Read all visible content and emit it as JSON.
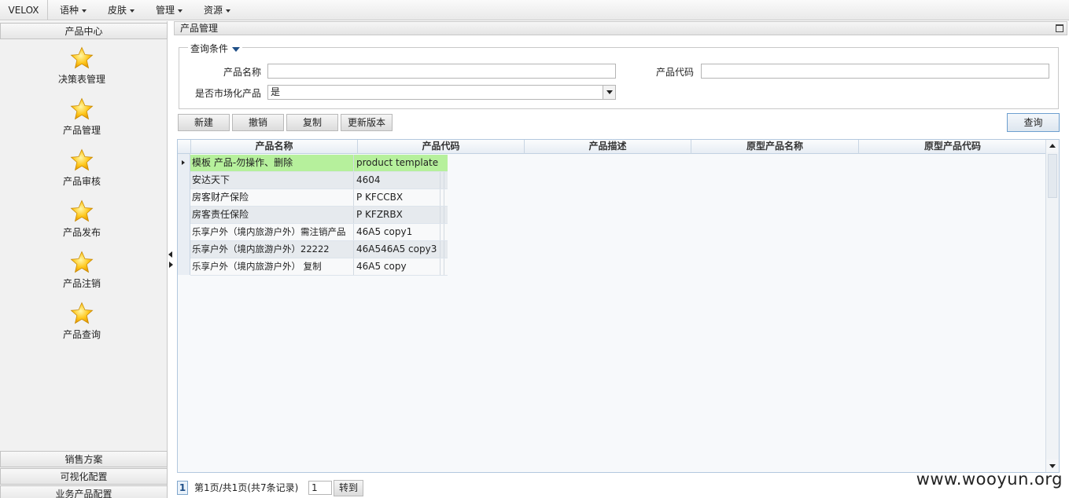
{
  "menubar": {
    "brand": "VELOX",
    "items": [
      {
        "label": "语种"
      },
      {
        "label": "皮肤"
      },
      {
        "label": "管理"
      },
      {
        "label": "资源"
      }
    ]
  },
  "sidebar": {
    "section_title": "产品中心",
    "items": [
      {
        "label": "决策表管理",
        "icon": "star-icon"
      },
      {
        "label": "产品管理",
        "icon": "star-icon"
      },
      {
        "label": "产品审核",
        "icon": "star-icon"
      },
      {
        "label": "产品发布",
        "icon": "star-icon"
      },
      {
        "label": "产品注销",
        "icon": "star-icon"
      },
      {
        "label": "产品查询",
        "icon": "star-icon"
      }
    ],
    "bottom_sections": [
      {
        "label": "销售方案"
      },
      {
        "label": "可视化配置"
      },
      {
        "label": "业务产品配置"
      }
    ]
  },
  "panel": {
    "title": "产品管理"
  },
  "query": {
    "legend": "查询条件",
    "product_name_label": "产品名称",
    "product_name_value": "",
    "product_code_label": "产品代码",
    "product_code_value": "",
    "marketed_label": "是否市场化产品",
    "marketed_value": "是"
  },
  "toolbar": {
    "new_label": "新建",
    "revoke_label": "撤销",
    "copy_label": "复制",
    "update_version_label": "更新版本",
    "search_label": "查询"
  },
  "grid": {
    "columns": [
      "产品名称",
      "产品代码",
      "产品描述",
      "原型产品名称",
      "原型产品代码"
    ],
    "rows": [
      {
        "name": "模板 产品-勿操作、删除",
        "code": "product template"
      },
      {
        "name": "安达天下",
        "code": "4604"
      },
      {
        "name": "房客财产保险",
        "code": "P KFCCBX"
      },
      {
        "name": "房客责任保险",
        "code": "P KFZRBX"
      },
      {
        "name": "乐享户外（境内旅游户外）需注销产品",
        "code": "46A5 copy1"
      },
      {
        "name": "乐享户外（境内旅游户外）22222",
        "code": "46A546A5 copy3"
      },
      {
        "name": "乐享户外（境内旅游户外） 复制",
        "code": "46A5 copy"
      }
    ],
    "selected_row": 0
  },
  "pager": {
    "current_page": "1",
    "summary": "第1页/共1页(共7条记录)",
    "goto_value": "1",
    "goto_label": "转到"
  },
  "watermark": "www.wooyun.org",
  "colors": {
    "selected_row": "#b6f09c",
    "accent": "#1f4f87"
  }
}
